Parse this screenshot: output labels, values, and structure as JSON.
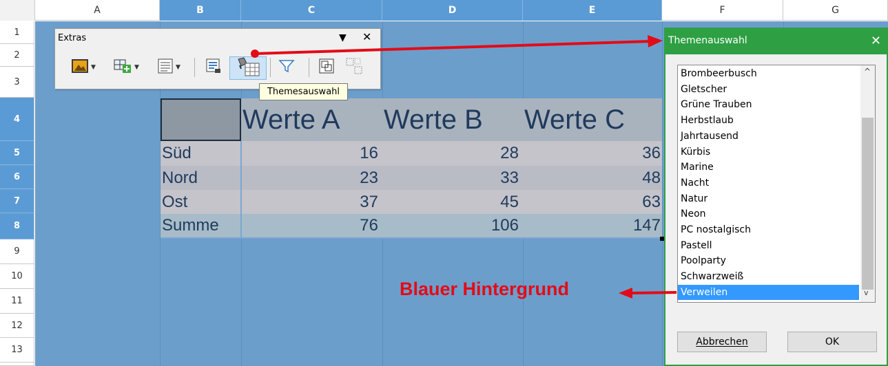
{
  "columns": [
    "A",
    "B",
    "C",
    "D",
    "E",
    "F",
    "G"
  ],
  "rows": [
    "1",
    "2",
    "3",
    "4",
    "5",
    "6",
    "7",
    "8",
    "9",
    "10",
    "11",
    "12",
    "13"
  ],
  "toolbar": {
    "title": "Extras",
    "menu_glyph": "▼",
    "close_glyph": "✕",
    "tooltip": "Themesauswahl",
    "icons": [
      "image-icon",
      "insert-object-icon",
      "list-icon",
      "preview-icon",
      "theme-icon",
      "filter-icon",
      "group-icon",
      "ungroup-icon"
    ]
  },
  "table": {
    "headers": [
      "Werte A",
      "Werte B",
      "Werte C"
    ],
    "rows": [
      {
        "label": "Süd",
        "values": [
          "16",
          "28",
          "36"
        ]
      },
      {
        "label": "Nord",
        "values": [
          "23",
          "33",
          "48"
        ]
      },
      {
        "label": "Ost",
        "values": [
          "37",
          "45",
          "63"
        ]
      },
      {
        "label": "Summe",
        "values": [
          "76",
          "106",
          "147"
        ]
      }
    ]
  },
  "dialog": {
    "title": "Themenauswahl",
    "close_glyph": "✕",
    "items": [
      "Brombeerbusch",
      "Gletscher",
      "Grüne Trauben",
      "Herbstlaub",
      "Jahrtausend",
      "Kürbis",
      "Marine",
      "Nacht",
      "Natur",
      "Neon",
      "PC nostalgisch",
      "Pastell",
      "Poolparty",
      "Schwarzweiß",
      "Verweilen"
    ],
    "selected": "Verweilen",
    "cancel": "Abbrechen",
    "ok": "OK",
    "scroll_up": "^",
    "scroll_down": "v"
  },
  "annotation": "Blauer Hintergrund",
  "colors": {
    "accent_green": "#2ea043",
    "selection_blue": "#3399ff",
    "arrow_red": "#e30b17",
    "sheet_blue": "#6c9ecc"
  }
}
